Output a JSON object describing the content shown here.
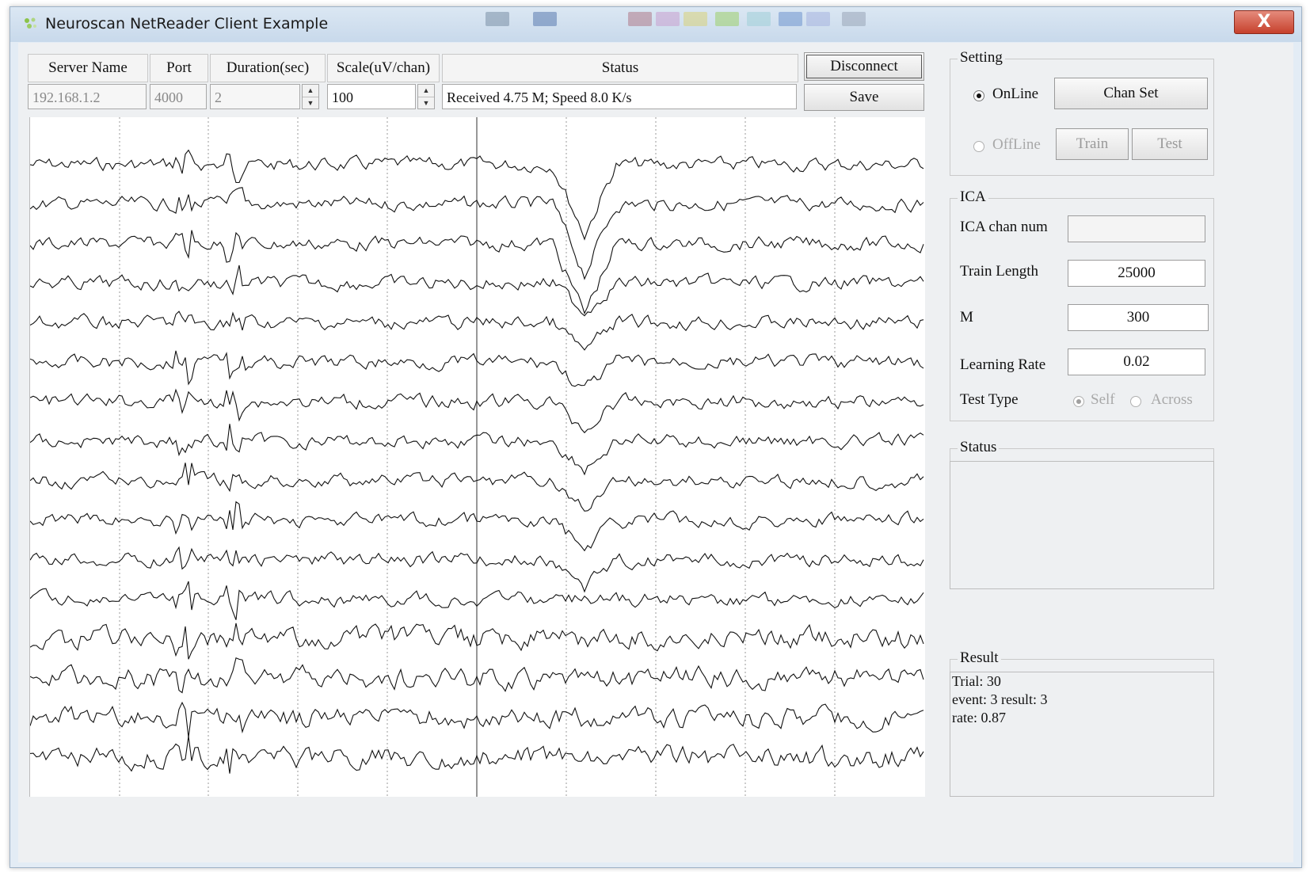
{
  "window": {
    "title": "Neuroscan NetReader Client Example",
    "close_label": "X"
  },
  "connection": {
    "headers": {
      "server_name": "Server Name",
      "port": "Port",
      "duration": "Duration(sec)",
      "scale": "Scale(uV/chan)",
      "status": "Status"
    },
    "server_name": "192.168.1.2",
    "port": "4000",
    "duration": "2",
    "scale": "100",
    "status": "Received 4.75 M; Speed 8.0 K/s",
    "disconnect_label": "Disconnect",
    "save_label": "Save"
  },
  "eeg": {
    "channel_count": 16,
    "description_hidden": true
  },
  "setting": {
    "group_label": "Setting",
    "online_label": "OnLine",
    "offline_label": "OffLine",
    "chan_set_label": "Chan Set",
    "train_label": "Train",
    "test_label": "Test",
    "mode": "online"
  },
  "ica": {
    "group_label": "ICA",
    "chan_num_label": "ICA chan num",
    "chan_num_value": "",
    "train_length_label": "Train Length",
    "train_length_value": "25000",
    "m_label": "M",
    "m_value": "300",
    "learning_rate_label": "Learning Rate",
    "learning_rate_value": "0.02",
    "test_type_label": "Test Type",
    "self_label": "Self",
    "across_label": "Across",
    "test_type": "self"
  },
  "status": {
    "group_label": "Status"
  },
  "result": {
    "group_label": "Result",
    "line1": "Trial: 30",
    "line2": "event: 3  result: 3",
    "line3": "rate: 0.87"
  },
  "colors": {
    "window_bg": "#eef0f2",
    "title_bar": "#c8d9eb",
    "close_button": "#c6402c",
    "trace": "#111111"
  }
}
